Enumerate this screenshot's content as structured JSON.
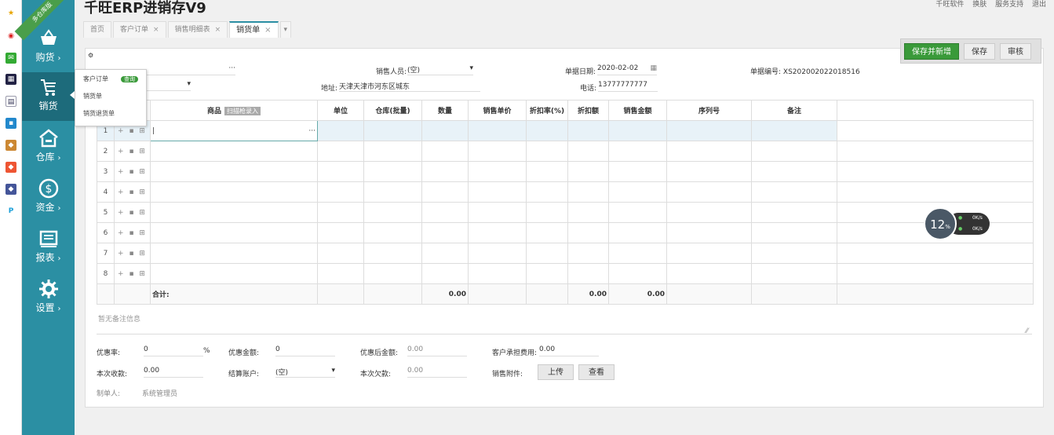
{
  "app": {
    "title": "千旺ERP进销存V9",
    "ribbon": "多仓库版"
  },
  "top_links": [
    "千旺软件",
    "换肤",
    "服务支持",
    "退出"
  ],
  "tabs": [
    {
      "label": "首页"
    },
    {
      "label": "客户订单"
    },
    {
      "label": "销售明细表"
    },
    {
      "label": "销货单"
    }
  ],
  "sidebar": {
    "items": [
      {
        "label": "购货"
      },
      {
        "label": "销货"
      },
      {
        "label": "仓库"
      },
      {
        "label": "资金"
      },
      {
        "label": "报表"
      },
      {
        "label": "设置"
      }
    ]
  },
  "submenu": {
    "items": [
      "客户订单",
      "销货单",
      "销货退货单"
    ],
    "badge": "查询"
  },
  "actions": {
    "save_new": "保存并新增",
    "save": "保存",
    "audit": "审核"
  },
  "form": {
    "sales_person_label": "销售人员:",
    "sales_person_value": "(空)",
    "date_label": "单据日期:",
    "date_value": "2020-02-02",
    "docno_label": "单据编号:",
    "docno_value": "XS202002022018516",
    "address_label": "地址:",
    "address_value": "天津天津市河东区城东",
    "phone_label": "电话:",
    "phone_value": "13777777777"
  },
  "grid": {
    "headers": [
      "商品",
      "单位",
      "仓库(批量)",
      "数量",
      "销售单价",
      "折扣率(%)",
      "折扣额",
      "销售金额",
      "序列号",
      "备注"
    ],
    "scan_label": "扫描枪录入",
    "rows": [
      "1",
      "2",
      "3",
      "4",
      "5",
      "6",
      "7",
      "8"
    ],
    "total_label": "合计:",
    "total_qty": "0.00",
    "total_discount": "0.00",
    "total_amount": "0.00"
  },
  "remark_placeholder": "暂无备注信息",
  "footer": {
    "discount_rate_label": "优惠率:",
    "discount_rate_value": "0",
    "percent": "%",
    "discount_amount_label": "优惠金额:",
    "discount_amount_value": "0",
    "after_discount_label": "优惠后金额:",
    "after_discount_value": "0.00",
    "customer_fee_label": "客户承担费用:",
    "customer_fee_value": "0.00",
    "received_label": "本次收款:",
    "received_value": "0.00",
    "account_label": "结算账户:",
    "account_value": "(空)",
    "owed_label": "本次欠款:",
    "owed_value": "0.00",
    "attachment_label": "销售附件:",
    "upload": "上传",
    "view": "查看",
    "creator_label": "制单人:",
    "creator_value": "系统管理员"
  },
  "speed": {
    "percent": "12",
    "unit": "%",
    "up": "0K/s",
    "down": "0K/s"
  }
}
